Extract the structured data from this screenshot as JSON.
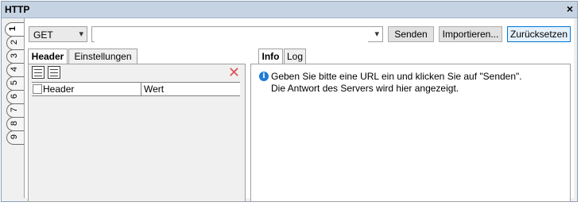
{
  "window": {
    "title": "HTTP",
    "close_icon": "close-icon"
  },
  "side_tabs": [
    "1",
    "2",
    "3",
    "4",
    "5",
    "6",
    "7",
    "8",
    "9"
  ],
  "toolbar": {
    "method": "GET",
    "url_placeholder": "",
    "url_value": "",
    "send_label": "Senden",
    "import_label": "Importieren...",
    "reset_label": "Zurücksetzen"
  },
  "left_tabs": {
    "header_label": "Header",
    "settings_label": "Einstellungen"
  },
  "header_grid": {
    "columns": [
      "Header",
      "Wert"
    ]
  },
  "right_tabs": {
    "info_label": "Info",
    "log_label": "Log"
  },
  "info": {
    "line1": "Geben Sie bitte eine URL ein und klicken Sie auf \"Senden\".",
    "line2": "Die Antwort des Servers wird hier angezeigt."
  },
  "colors": {
    "titlebar": "#c6d3e2",
    "info_icon": "#1e7bd6",
    "delete_icon": "#d9534f"
  }
}
